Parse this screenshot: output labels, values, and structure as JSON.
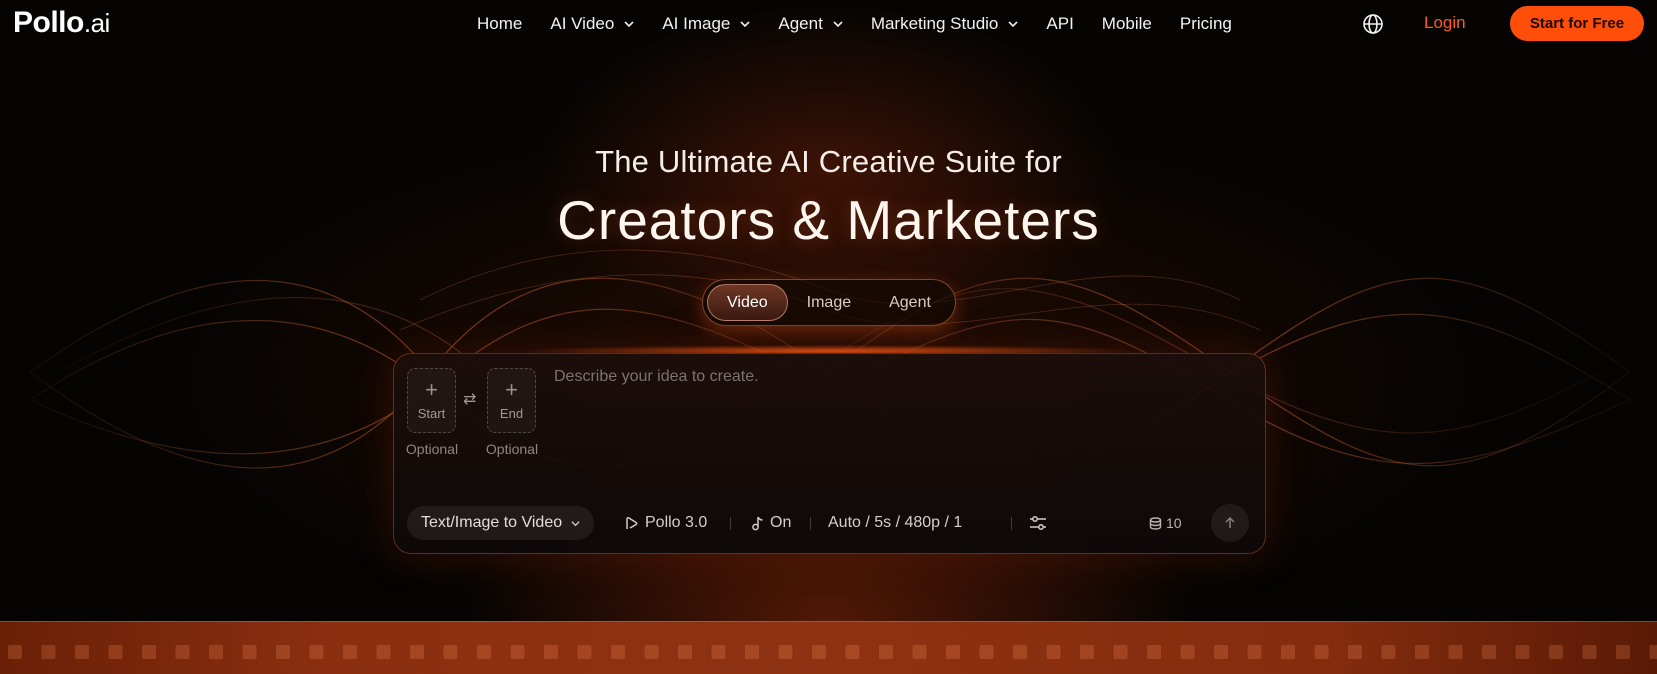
{
  "brand": {
    "name": "Pollo",
    "suffix": ".ai"
  },
  "nav": {
    "items": [
      {
        "label": "Home",
        "dropdown": false
      },
      {
        "label": "AI Video",
        "dropdown": true
      },
      {
        "label": "AI Image",
        "dropdown": true
      },
      {
        "label": "Agent",
        "dropdown": true
      },
      {
        "label": "Marketing Studio",
        "dropdown": true
      },
      {
        "label": "API",
        "dropdown": false
      },
      {
        "label": "Mobile",
        "dropdown": false
      },
      {
        "label": "Pricing",
        "dropdown": false
      }
    ],
    "language_icon": "globe-icon",
    "login": "Login",
    "cta": "Start for Free"
  },
  "hero": {
    "subtitle": "The Ultimate AI Creative Suite for",
    "title": "Creators & Marketers"
  },
  "mode_tabs": {
    "items": [
      "Video",
      "Image",
      "Agent"
    ],
    "active": "Video"
  },
  "composer": {
    "start_frame": {
      "label": "Start",
      "note": "Optional"
    },
    "end_frame": {
      "label": "End",
      "note": "Optional"
    },
    "swap_icon": "swap-arrows-icon",
    "prompt_placeholder": "Describe your idea to create.",
    "prompt_value": "",
    "mode_select": "Text/Image to Video",
    "model": "Pollo 3.0",
    "sound": "On",
    "settings": "Auto / 5s / 480p / 1",
    "credits": "10"
  },
  "colors": {
    "accent": "#ff4d0a",
    "login": "#ff5a1f",
    "background": "#050403",
    "strip": "#8a2f10"
  }
}
